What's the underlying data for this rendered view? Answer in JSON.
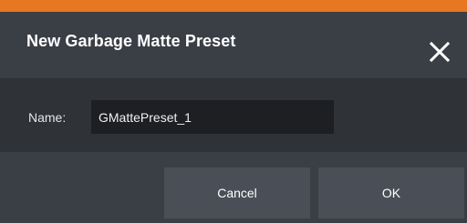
{
  "dialog": {
    "title": "New Garbage Matte Preset",
    "close_icon": "close-icon",
    "accent_color": "#e87722"
  },
  "form": {
    "name_label": "Name:",
    "name_value": "GMattePreset_1"
  },
  "footer": {
    "cancel_label": "Cancel",
    "ok_label": "OK"
  }
}
